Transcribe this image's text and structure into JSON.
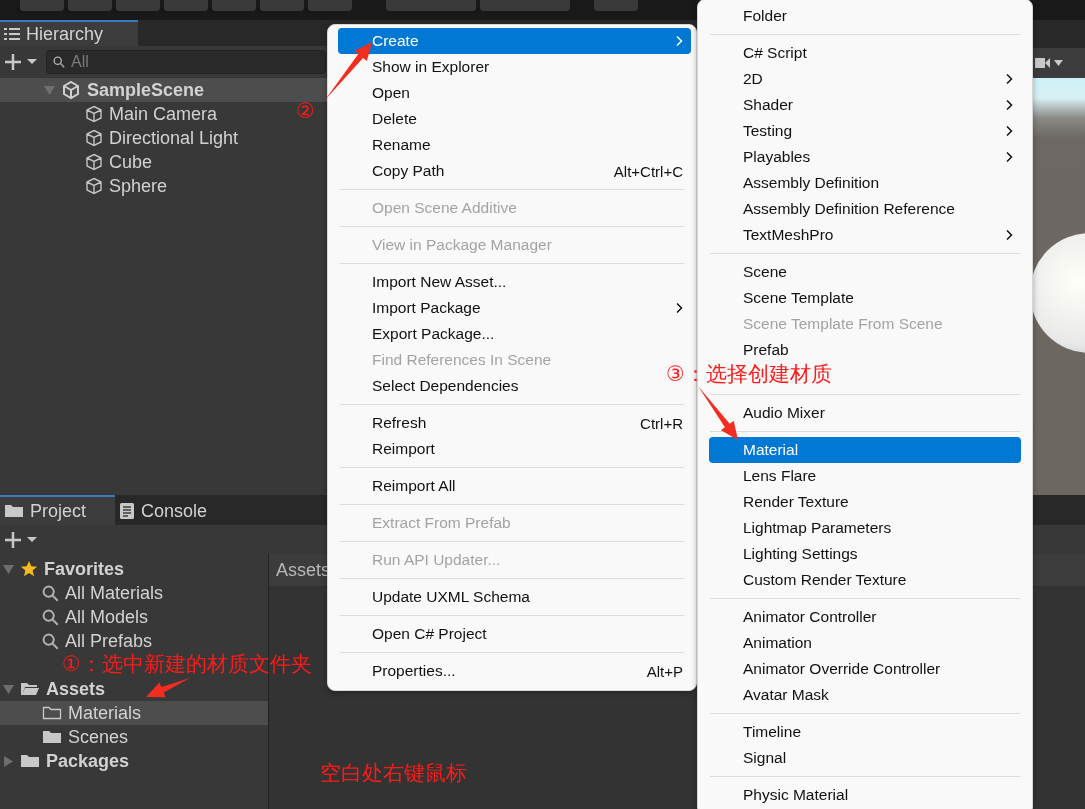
{
  "hierarchy": {
    "title": "Hierarchy",
    "search": {
      "placeholder": "All"
    },
    "scene": {
      "name": "SampleScene",
      "expanded": true,
      "selected": true,
      "children": [
        {
          "name": "Main Camera"
        },
        {
          "name": "Directional Light"
        },
        {
          "name": "Cube"
        },
        {
          "name": "Sphere"
        }
      ]
    }
  },
  "project": {
    "tabs": [
      {
        "label": "Project",
        "selected": true
      },
      {
        "label": "Console",
        "selected": false
      }
    ],
    "favorites": {
      "label": "Favorites",
      "expanded": true,
      "items": [
        {
          "name": "All Materials"
        },
        {
          "name": "All Models"
        },
        {
          "name": "All Prefabs"
        }
      ]
    },
    "assets": {
      "label": "Assets",
      "expanded": true,
      "children": [
        {
          "name": "Materials",
          "selected": true
        },
        {
          "name": "Scenes",
          "selected": false
        }
      ]
    },
    "packages": {
      "label": "Packages",
      "expanded": false
    },
    "breadcrumb": "Assets"
  },
  "context_menu": {
    "items": [
      {
        "kind": "item",
        "label": "Create",
        "submenu": true,
        "disabled": false,
        "selected": true
      },
      {
        "kind": "item",
        "label": "Show in Explorer",
        "submenu": false,
        "disabled": false,
        "selected": false
      },
      {
        "kind": "item",
        "label": "Open",
        "submenu": false,
        "disabled": false,
        "selected": false
      },
      {
        "kind": "item",
        "label": "Delete",
        "submenu": false,
        "disabled": false,
        "selected": false
      },
      {
        "kind": "item",
        "label": "Rename",
        "submenu": false,
        "disabled": false,
        "selected": false
      },
      {
        "kind": "item",
        "label": "Copy Path",
        "shortcut": "Alt+Ctrl+C",
        "submenu": false,
        "disabled": false,
        "selected": false
      },
      {
        "kind": "separator"
      },
      {
        "kind": "item",
        "label": "Open Scene Additive",
        "submenu": false,
        "disabled": true,
        "selected": false
      },
      {
        "kind": "separator"
      },
      {
        "kind": "item",
        "label": "View in Package Manager",
        "submenu": false,
        "disabled": true,
        "selected": false
      },
      {
        "kind": "separator"
      },
      {
        "kind": "item",
        "label": "Import New Asset...",
        "submenu": false,
        "disabled": false,
        "selected": false
      },
      {
        "kind": "item",
        "label": "Import Package",
        "submenu": true,
        "disabled": false,
        "selected": false
      },
      {
        "kind": "item",
        "label": "Export Package...",
        "submenu": false,
        "disabled": false,
        "selected": false
      },
      {
        "kind": "item",
        "label": "Find References In Scene",
        "submenu": false,
        "disabled": true,
        "selected": false
      },
      {
        "kind": "item",
        "label": "Select Dependencies",
        "submenu": false,
        "disabled": false,
        "selected": false
      },
      {
        "kind": "separator"
      },
      {
        "kind": "item",
        "label": "Refresh",
        "shortcut": "Ctrl+R",
        "submenu": false,
        "disabled": false,
        "selected": false
      },
      {
        "kind": "item",
        "label": "Reimport",
        "submenu": false,
        "disabled": false,
        "selected": false
      },
      {
        "kind": "separator"
      },
      {
        "kind": "item",
        "label": "Reimport All",
        "submenu": false,
        "disabled": false,
        "selected": false
      },
      {
        "kind": "separator"
      },
      {
        "kind": "item",
        "label": "Extract From Prefab",
        "submenu": false,
        "disabled": true,
        "selected": false
      },
      {
        "kind": "separator"
      },
      {
        "kind": "item",
        "label": "Run API Updater...",
        "submenu": false,
        "disabled": true,
        "selected": false
      },
      {
        "kind": "separator"
      },
      {
        "kind": "item",
        "label": "Update UXML Schema",
        "submenu": false,
        "disabled": false,
        "selected": false
      },
      {
        "kind": "separator"
      },
      {
        "kind": "item",
        "label": "Open C# Project",
        "submenu": false,
        "disabled": false,
        "selected": false
      },
      {
        "kind": "separator"
      },
      {
        "kind": "item",
        "label": "Properties...",
        "shortcut": "Alt+P",
        "submenu": false,
        "disabled": false,
        "selected": false
      }
    ]
  },
  "create_submenu": {
    "items": [
      {
        "kind": "item",
        "label": "Folder",
        "submenu": false,
        "disabled": false,
        "selected": false
      },
      {
        "kind": "separator"
      },
      {
        "kind": "item",
        "label": "C# Script",
        "submenu": false,
        "disabled": false,
        "selected": false
      },
      {
        "kind": "item",
        "label": "2D",
        "submenu": true,
        "disabled": false,
        "selected": false
      },
      {
        "kind": "item",
        "label": "Shader",
        "submenu": true,
        "disabled": false,
        "selected": false
      },
      {
        "kind": "item",
        "label": "Testing",
        "submenu": true,
        "disabled": false,
        "selected": false
      },
      {
        "kind": "item",
        "label": "Playables",
        "submenu": true,
        "disabled": false,
        "selected": false
      },
      {
        "kind": "item",
        "label": "Assembly Definition",
        "submenu": false,
        "disabled": false,
        "selected": false
      },
      {
        "kind": "item",
        "label": "Assembly Definition Reference",
        "submenu": false,
        "disabled": false,
        "selected": false
      },
      {
        "kind": "item",
        "label": "TextMeshPro",
        "submenu": true,
        "disabled": false,
        "selected": false
      },
      {
        "kind": "separator"
      },
      {
        "kind": "item",
        "label": "Scene",
        "submenu": false,
        "disabled": false,
        "selected": false
      },
      {
        "kind": "item",
        "label": "Scene Template",
        "submenu": false,
        "disabled": false,
        "selected": false
      },
      {
        "kind": "item",
        "label": "Scene Template From Scene",
        "submenu": false,
        "disabled": true,
        "selected": false
      },
      {
        "kind": "item",
        "label": "Prefab",
        "submenu": false,
        "disabled": false,
        "selected": false
      },
      {
        "kind": "blank"
      },
      {
        "kind": "separator"
      },
      {
        "kind": "item",
        "label": "Audio Mixer",
        "submenu": false,
        "disabled": false,
        "selected": false
      },
      {
        "kind": "separator"
      },
      {
        "kind": "item",
        "label": "Material",
        "submenu": false,
        "disabled": false,
        "selected": true
      },
      {
        "kind": "item",
        "label": "Lens Flare",
        "submenu": false,
        "disabled": false,
        "selected": false
      },
      {
        "kind": "item",
        "label": "Render Texture",
        "submenu": false,
        "disabled": false,
        "selected": false
      },
      {
        "kind": "item",
        "label": "Lightmap Parameters",
        "submenu": false,
        "disabled": false,
        "selected": false
      },
      {
        "kind": "item",
        "label": "Lighting Settings",
        "submenu": false,
        "disabled": false,
        "selected": false
      },
      {
        "kind": "item",
        "label": "Custom Render Texture",
        "submenu": false,
        "disabled": false,
        "selected": false
      },
      {
        "kind": "separator"
      },
      {
        "kind": "item",
        "label": "Animator Controller",
        "submenu": false,
        "disabled": false,
        "selected": false
      },
      {
        "kind": "item",
        "label": "Animation",
        "submenu": false,
        "disabled": false,
        "selected": false
      },
      {
        "kind": "item",
        "label": "Animator Override Controller",
        "submenu": false,
        "disabled": false,
        "selected": false
      },
      {
        "kind": "item",
        "label": "Avatar Mask",
        "submenu": false,
        "disabled": false,
        "selected": false
      },
      {
        "kind": "separator"
      },
      {
        "kind": "item",
        "label": "Timeline",
        "submenu": false,
        "disabled": false,
        "selected": false
      },
      {
        "kind": "item",
        "label": "Signal",
        "submenu": false,
        "disabled": false,
        "selected": false
      },
      {
        "kind": "separator"
      },
      {
        "kind": "item",
        "label": "Physic Material",
        "submenu": false,
        "disabled": false,
        "selected": false
      }
    ]
  },
  "annotations": [
    {
      "label": "②"
    },
    {
      "label": "③：选择创建材质"
    },
    {
      "label": "①：选中新建的材质文件夹"
    },
    {
      "label": "空白处右键鼠标"
    }
  ]
}
